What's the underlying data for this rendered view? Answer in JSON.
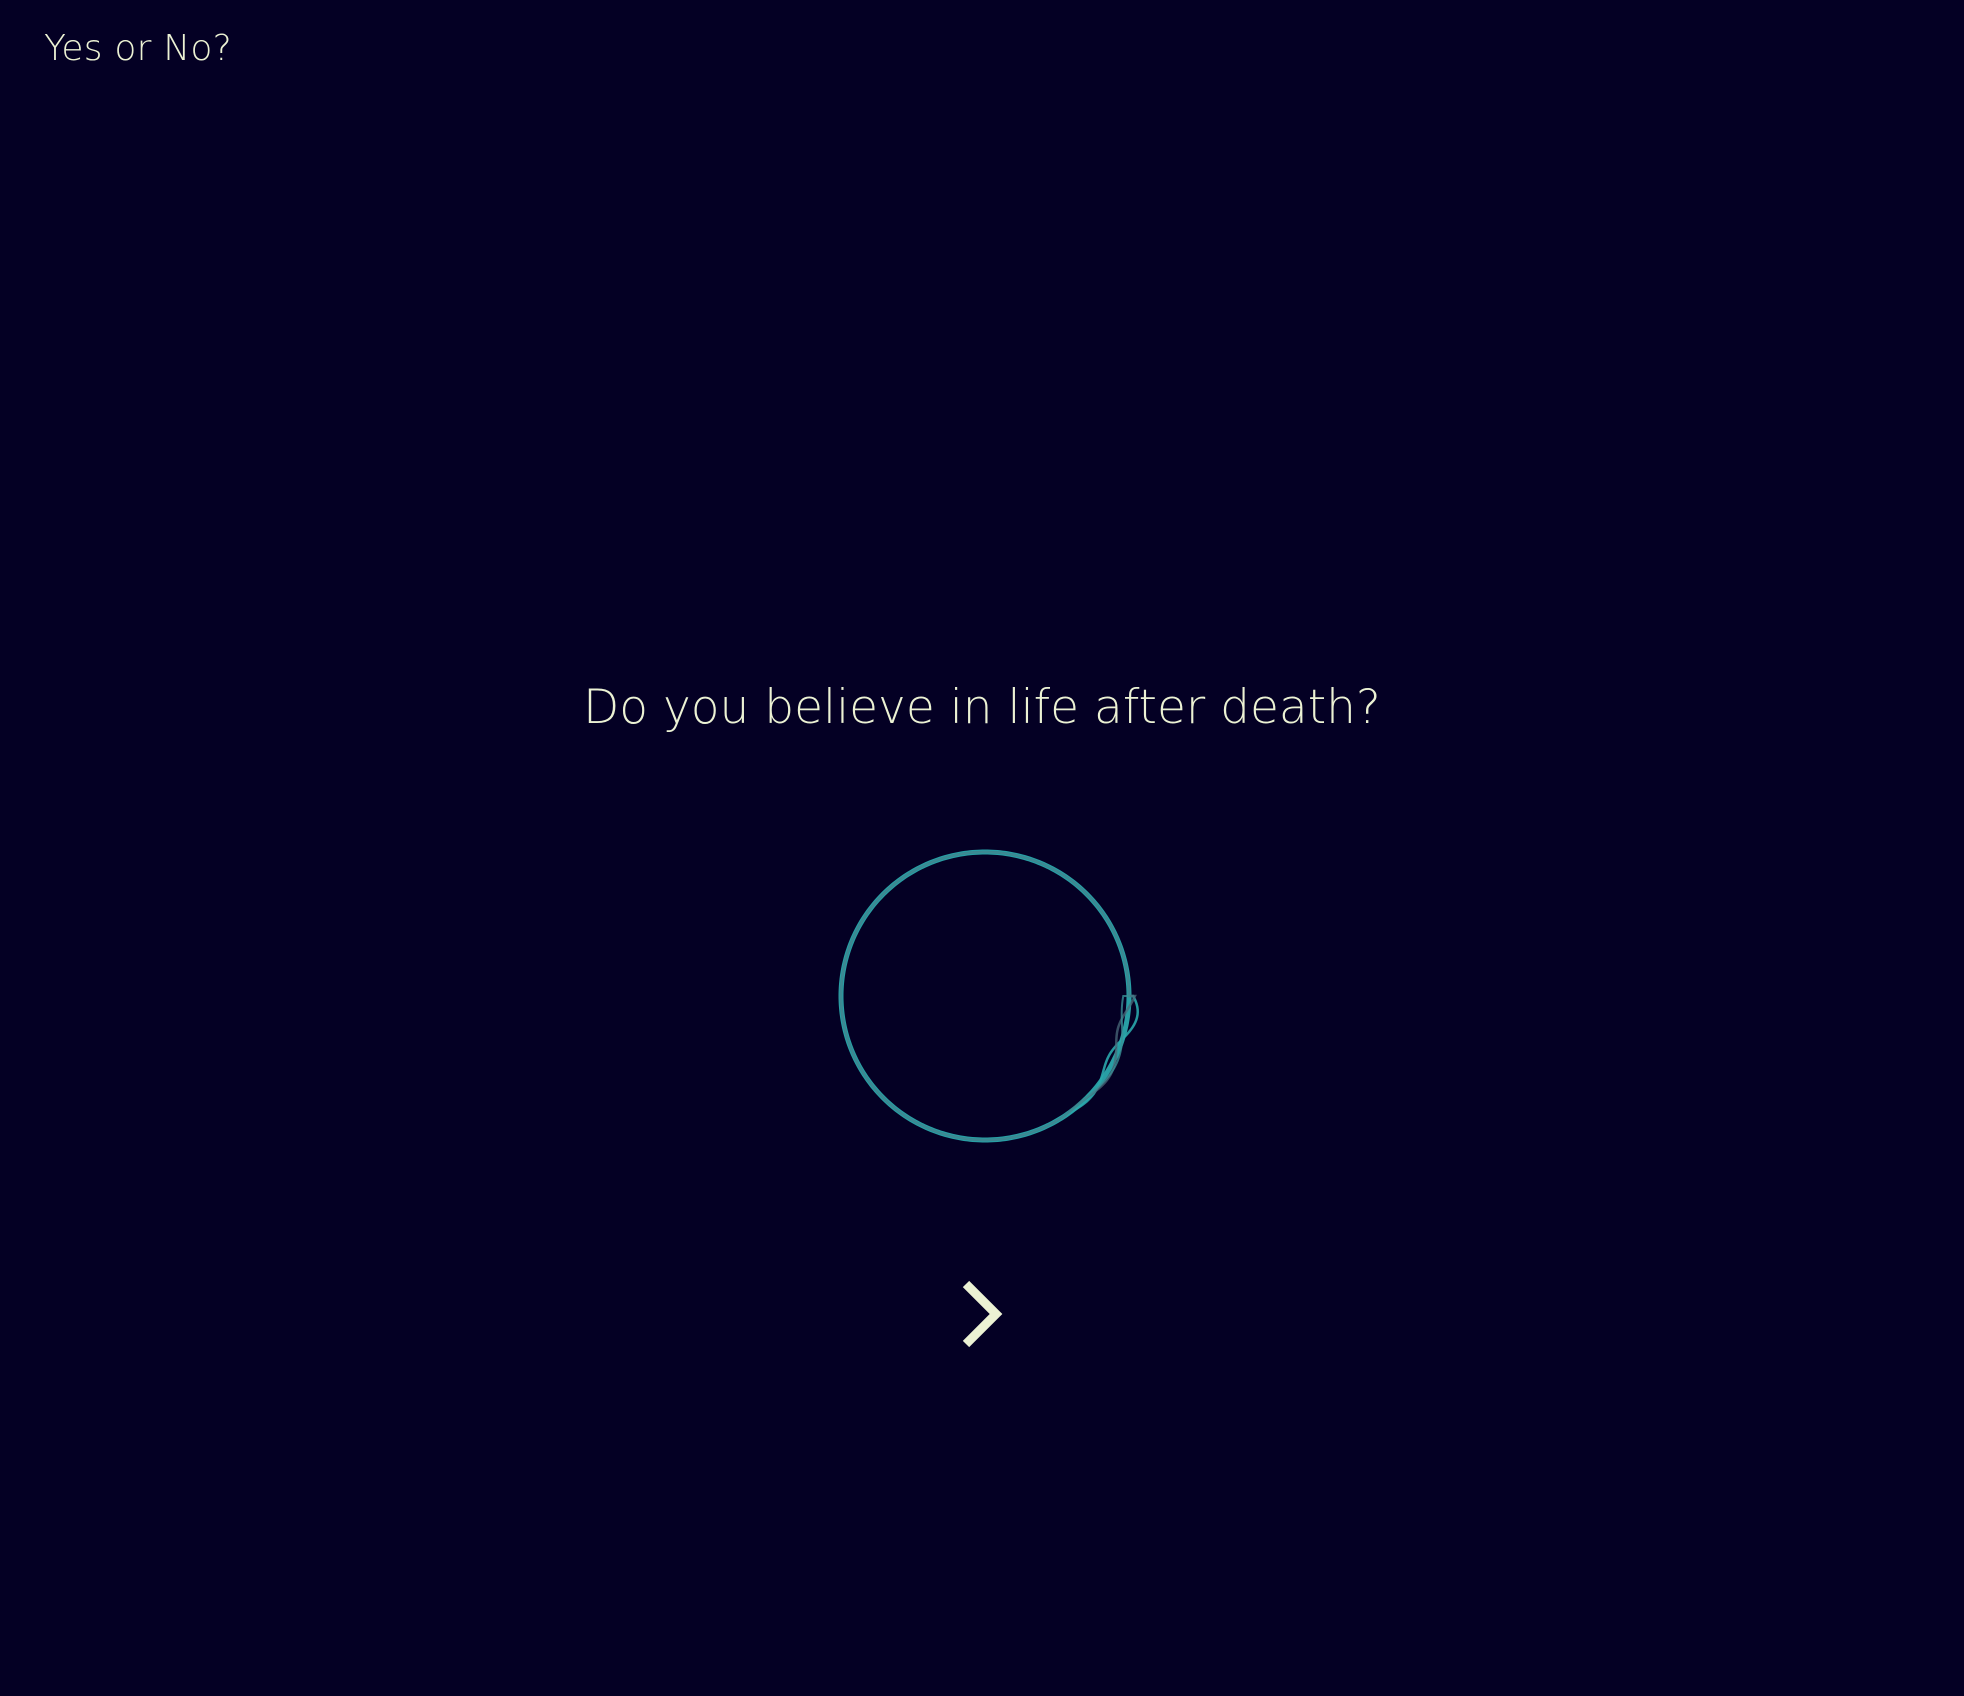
{
  "app": {
    "title": "Yes or No?"
  },
  "main": {
    "question": "Do you believe in life after death?",
    "next_icon": "chevron-right-icon"
  },
  "colors": {
    "background": "#040024",
    "text": "#ecf2d4",
    "accent": "#27a3a8"
  }
}
